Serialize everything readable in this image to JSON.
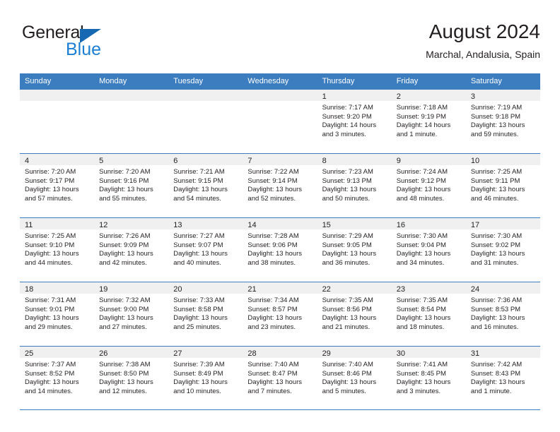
{
  "brand": {
    "line1": "General",
    "line2": "Blue",
    "triangle_color": "#1668b3",
    "line2_color": "#1c7fd4"
  },
  "header": {
    "title": "August 2024",
    "subtitle": "Marchal, Andalusia, Spain"
  },
  "theme": {
    "header_blue": "#3b7dbf",
    "day_band_gray": "#f0f0f0",
    "text": "#231f20"
  },
  "calendar": {
    "weekdays": [
      "Sunday",
      "Monday",
      "Tuesday",
      "Wednesday",
      "Thursday",
      "Friday",
      "Saturday"
    ],
    "labels": {
      "sunrise": "Sunrise:",
      "sunset": "Sunset:",
      "daylight": "Daylight:"
    },
    "weeks": [
      [
        {
          "day": "",
          "empty": true
        },
        {
          "day": "",
          "empty": true
        },
        {
          "day": "",
          "empty": true
        },
        {
          "day": "",
          "empty": true
        },
        {
          "day": "1",
          "sunrise": "Sunrise: 7:17 AM",
          "sunset": "Sunset: 9:20 PM",
          "daylight": "Daylight: 14 hours and 3 minutes."
        },
        {
          "day": "2",
          "sunrise": "Sunrise: 7:18 AM",
          "sunset": "Sunset: 9:19 PM",
          "daylight": "Daylight: 14 hours and 1 minute."
        },
        {
          "day": "3",
          "sunrise": "Sunrise: 7:19 AM",
          "sunset": "Sunset: 9:18 PM",
          "daylight": "Daylight: 13 hours and 59 minutes."
        }
      ],
      [
        {
          "day": "4",
          "sunrise": "Sunrise: 7:20 AM",
          "sunset": "Sunset: 9:17 PM",
          "daylight": "Daylight: 13 hours and 57 minutes."
        },
        {
          "day": "5",
          "sunrise": "Sunrise: 7:20 AM",
          "sunset": "Sunset: 9:16 PM",
          "daylight": "Daylight: 13 hours and 55 minutes."
        },
        {
          "day": "6",
          "sunrise": "Sunrise: 7:21 AM",
          "sunset": "Sunset: 9:15 PM",
          "daylight": "Daylight: 13 hours and 54 minutes."
        },
        {
          "day": "7",
          "sunrise": "Sunrise: 7:22 AM",
          "sunset": "Sunset: 9:14 PM",
          "daylight": "Daylight: 13 hours and 52 minutes."
        },
        {
          "day": "8",
          "sunrise": "Sunrise: 7:23 AM",
          "sunset": "Sunset: 9:13 PM",
          "daylight": "Daylight: 13 hours and 50 minutes."
        },
        {
          "day": "9",
          "sunrise": "Sunrise: 7:24 AM",
          "sunset": "Sunset: 9:12 PM",
          "daylight": "Daylight: 13 hours and 48 minutes."
        },
        {
          "day": "10",
          "sunrise": "Sunrise: 7:25 AM",
          "sunset": "Sunset: 9:11 PM",
          "daylight": "Daylight: 13 hours and 46 minutes."
        }
      ],
      [
        {
          "day": "11",
          "sunrise": "Sunrise: 7:25 AM",
          "sunset": "Sunset: 9:10 PM",
          "daylight": "Daylight: 13 hours and 44 minutes."
        },
        {
          "day": "12",
          "sunrise": "Sunrise: 7:26 AM",
          "sunset": "Sunset: 9:09 PM",
          "daylight": "Daylight: 13 hours and 42 minutes."
        },
        {
          "day": "13",
          "sunrise": "Sunrise: 7:27 AM",
          "sunset": "Sunset: 9:07 PM",
          "daylight": "Daylight: 13 hours and 40 minutes."
        },
        {
          "day": "14",
          "sunrise": "Sunrise: 7:28 AM",
          "sunset": "Sunset: 9:06 PM",
          "daylight": "Daylight: 13 hours and 38 minutes."
        },
        {
          "day": "15",
          "sunrise": "Sunrise: 7:29 AM",
          "sunset": "Sunset: 9:05 PM",
          "daylight": "Daylight: 13 hours and 36 minutes."
        },
        {
          "day": "16",
          "sunrise": "Sunrise: 7:30 AM",
          "sunset": "Sunset: 9:04 PM",
          "daylight": "Daylight: 13 hours and 34 minutes."
        },
        {
          "day": "17",
          "sunrise": "Sunrise: 7:30 AM",
          "sunset": "Sunset: 9:02 PM",
          "daylight": "Daylight: 13 hours and 31 minutes."
        }
      ],
      [
        {
          "day": "18",
          "sunrise": "Sunrise: 7:31 AM",
          "sunset": "Sunset: 9:01 PM",
          "daylight": "Daylight: 13 hours and 29 minutes."
        },
        {
          "day": "19",
          "sunrise": "Sunrise: 7:32 AM",
          "sunset": "Sunset: 9:00 PM",
          "daylight": "Daylight: 13 hours and 27 minutes."
        },
        {
          "day": "20",
          "sunrise": "Sunrise: 7:33 AM",
          "sunset": "Sunset: 8:58 PM",
          "daylight": "Daylight: 13 hours and 25 minutes."
        },
        {
          "day": "21",
          "sunrise": "Sunrise: 7:34 AM",
          "sunset": "Sunset: 8:57 PM",
          "daylight": "Daylight: 13 hours and 23 minutes."
        },
        {
          "day": "22",
          "sunrise": "Sunrise: 7:35 AM",
          "sunset": "Sunset: 8:56 PM",
          "daylight": "Daylight: 13 hours and 21 minutes."
        },
        {
          "day": "23",
          "sunrise": "Sunrise: 7:35 AM",
          "sunset": "Sunset: 8:54 PM",
          "daylight": "Daylight: 13 hours and 18 minutes."
        },
        {
          "day": "24",
          "sunrise": "Sunrise: 7:36 AM",
          "sunset": "Sunset: 8:53 PM",
          "daylight": "Daylight: 13 hours and 16 minutes."
        }
      ],
      [
        {
          "day": "25",
          "sunrise": "Sunrise: 7:37 AM",
          "sunset": "Sunset: 8:52 PM",
          "daylight": "Daylight: 13 hours and 14 minutes."
        },
        {
          "day": "26",
          "sunrise": "Sunrise: 7:38 AM",
          "sunset": "Sunset: 8:50 PM",
          "daylight": "Daylight: 13 hours and 12 minutes."
        },
        {
          "day": "27",
          "sunrise": "Sunrise: 7:39 AM",
          "sunset": "Sunset: 8:49 PM",
          "daylight": "Daylight: 13 hours and 10 minutes."
        },
        {
          "day": "28",
          "sunrise": "Sunrise: 7:40 AM",
          "sunset": "Sunset: 8:47 PM",
          "daylight": "Daylight: 13 hours and 7 minutes."
        },
        {
          "day": "29",
          "sunrise": "Sunrise: 7:40 AM",
          "sunset": "Sunset: 8:46 PM",
          "daylight": "Daylight: 13 hours and 5 minutes."
        },
        {
          "day": "30",
          "sunrise": "Sunrise: 7:41 AM",
          "sunset": "Sunset: 8:45 PM",
          "daylight": "Daylight: 13 hours and 3 minutes."
        },
        {
          "day": "31",
          "sunrise": "Sunrise: 7:42 AM",
          "sunset": "Sunset: 8:43 PM",
          "daylight": "Daylight: 13 hours and 1 minute."
        }
      ]
    ]
  }
}
